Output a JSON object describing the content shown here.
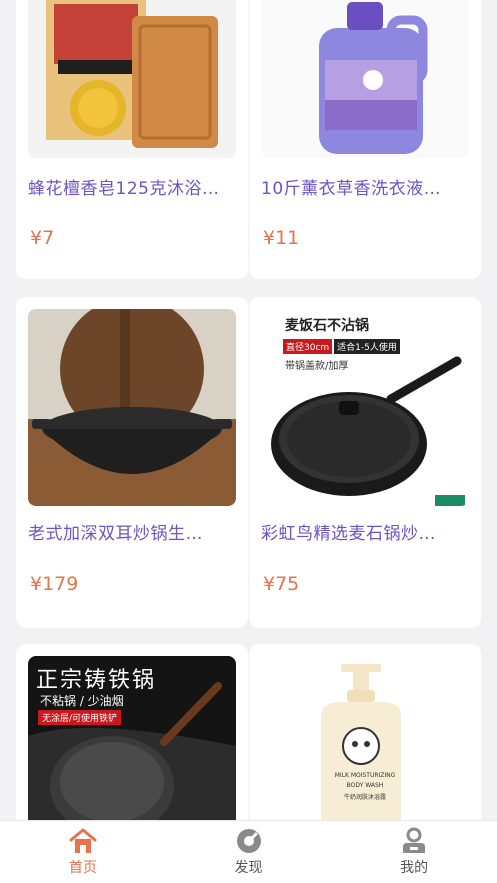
{
  "products": [
    {
      "title": "蜂花檀香皂125克沐浴…",
      "price": "¥7"
    },
    {
      "title": "10斤薰衣草香洗衣液…",
      "price": "¥11"
    },
    {
      "title": "老式加深双耳炒锅生…",
      "price": "¥179"
    },
    {
      "title": "彩虹鸟精选麦石锅炒…",
      "price": "¥75"
    },
    {
      "title": "",
      "price": ""
    },
    {
      "title": "",
      "price": ""
    }
  ],
  "image_text": {
    "pan_maifan": "麦饭石不沾锅",
    "pan_diameter": "直径30cm",
    "pan_people": "适合1-5人使用",
    "pan_lid": "带锅盖款/加厚",
    "castiron_title": "正宗铸铁锅",
    "castiron_sub": "不粘锅 / 少油烟",
    "castiron_tag": "无涂层/可使用铁铲",
    "bodywash_en1": "MILK MOISTURIZING",
    "bodywash_en2": "BODY WASH",
    "bodywash_cn": "牛奶润肤沐浴露"
  },
  "tabbar": {
    "items": [
      {
        "label": "首页",
        "icon": "home-icon",
        "active": true
      },
      {
        "label": "发现",
        "icon": "compass-icon",
        "active": false
      },
      {
        "label": "我的",
        "icon": "user-icon",
        "active": false
      }
    ]
  },
  "colors": {
    "accent": "#e8734a",
    "title": "#6b53c7",
    "background": "#f2f2f4"
  }
}
